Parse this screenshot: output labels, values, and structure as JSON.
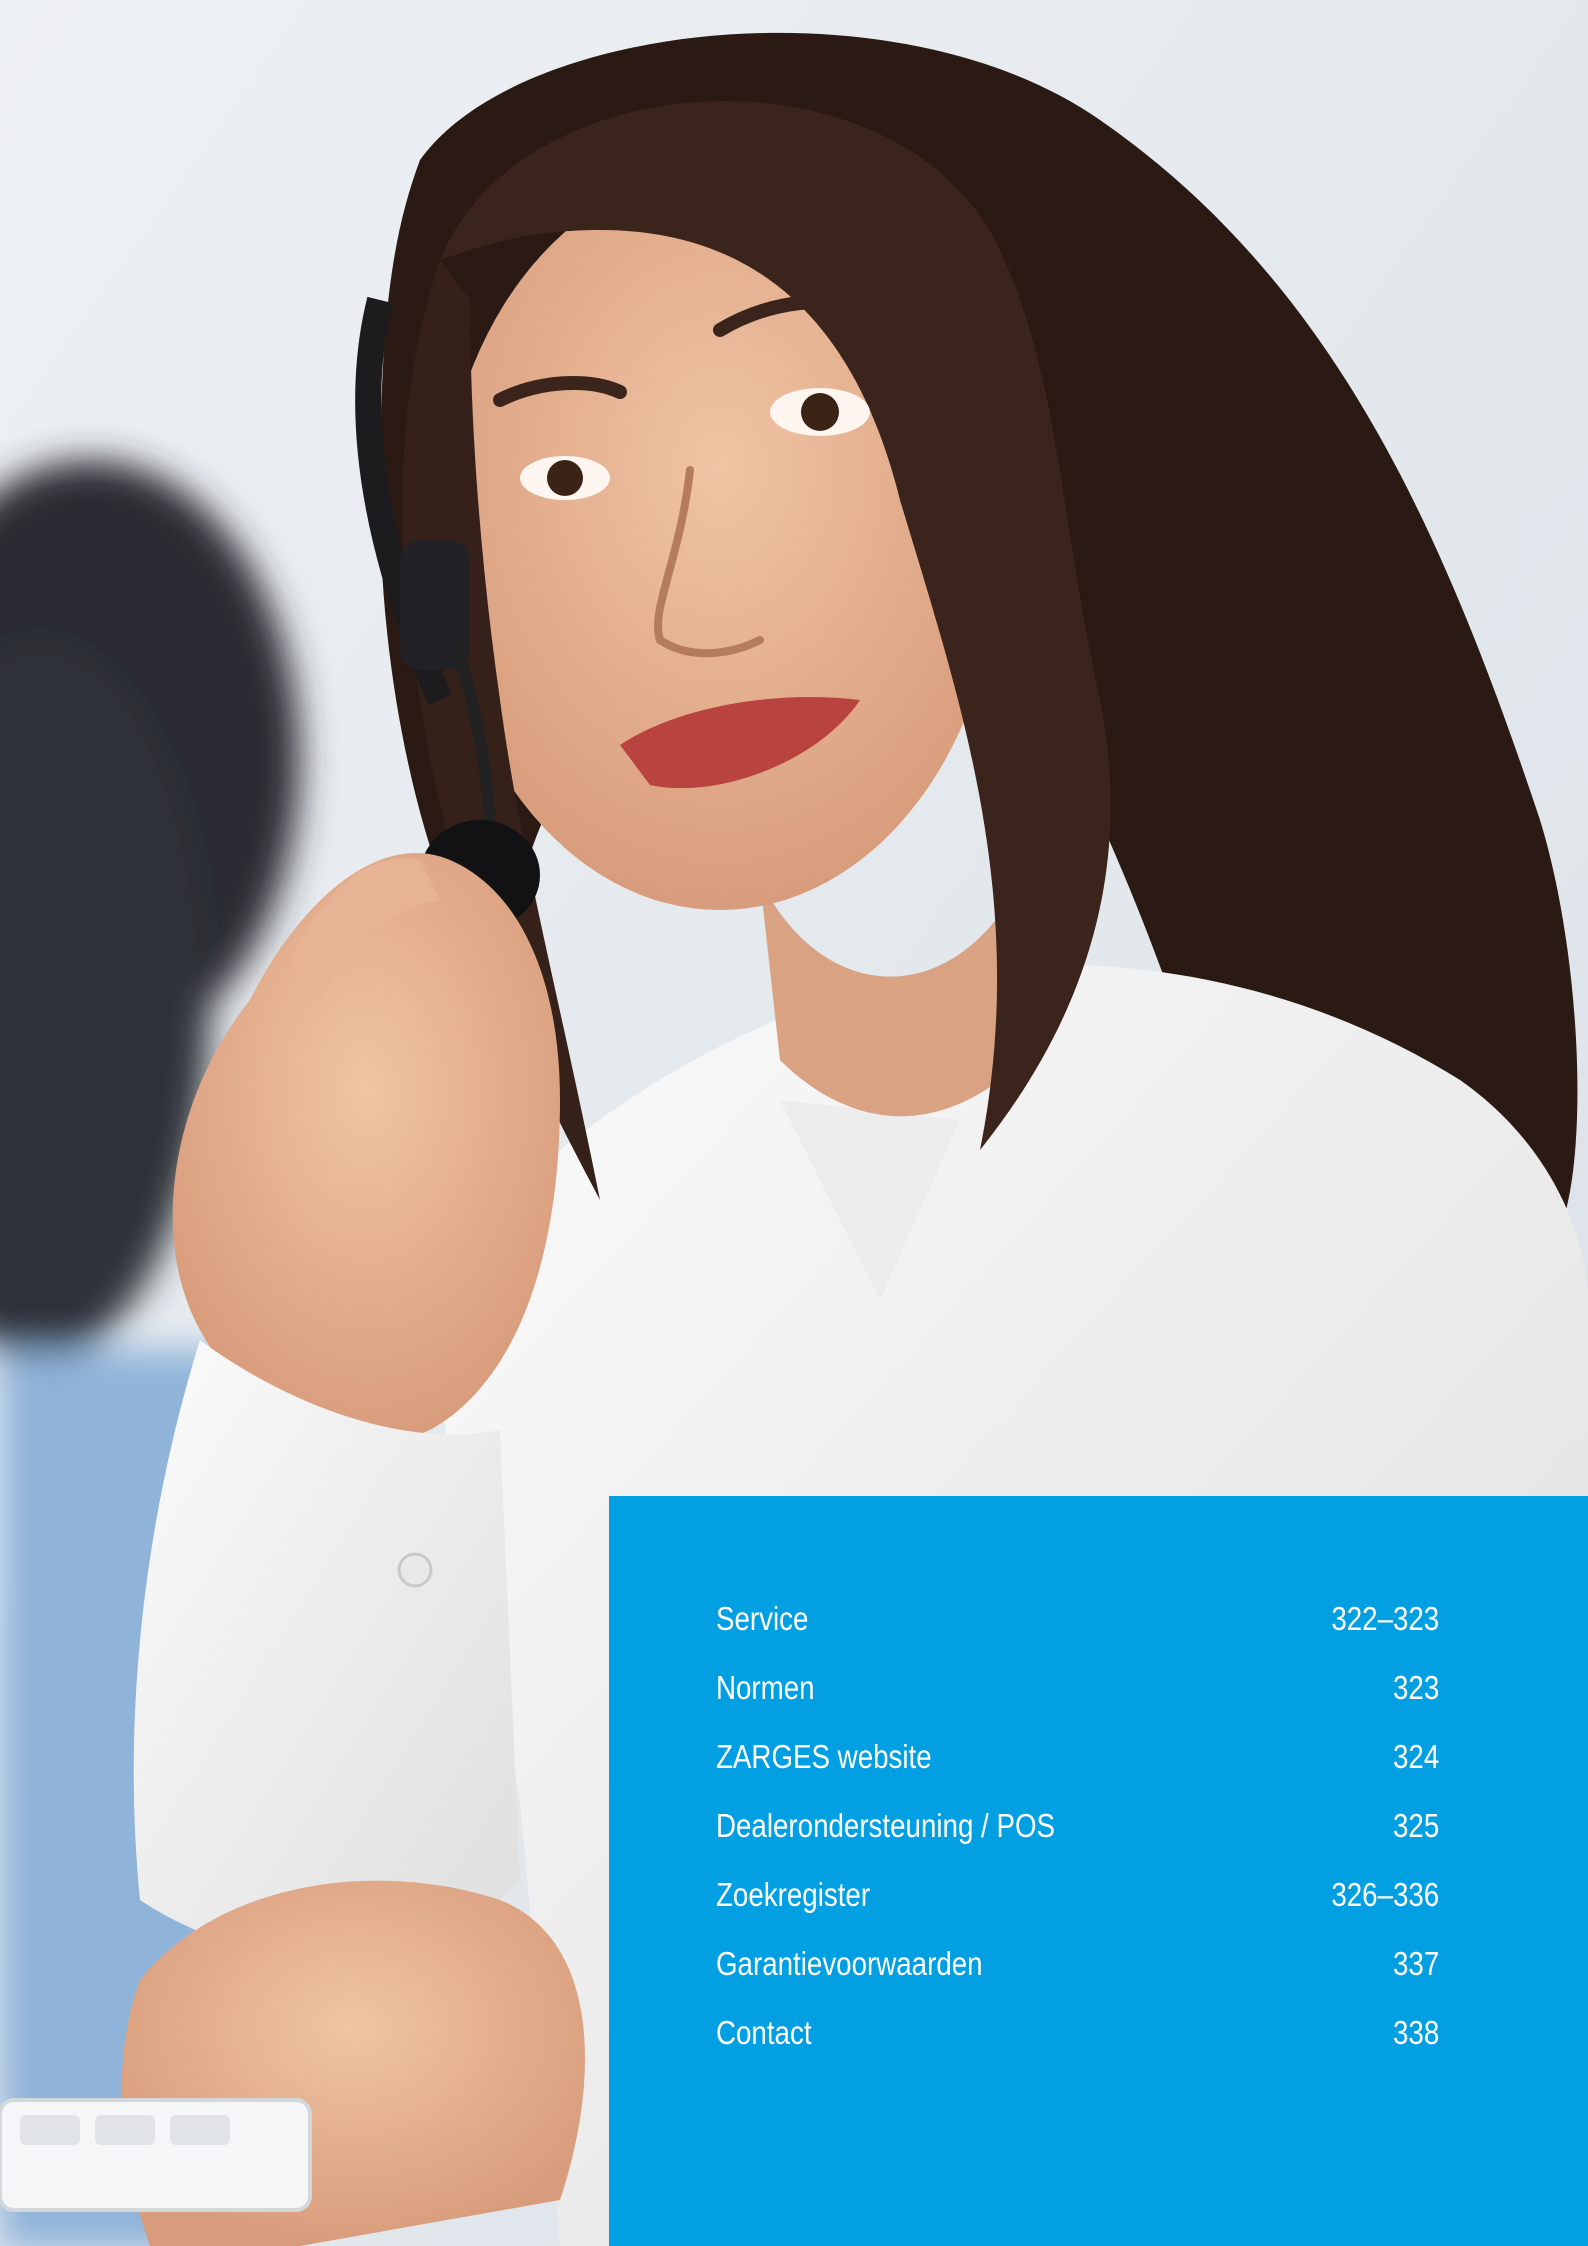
{
  "toc": {
    "items": [
      {
        "label": "Service",
        "pages": "322–323"
      },
      {
        "label": "Normen",
        "pages": "323"
      },
      {
        "label": "ZARGES website",
        "pages": "324"
      },
      {
        "label": "Dealerondersteuning / POS",
        "pages": "325"
      },
      {
        "label": "Zoekregister",
        "pages": "326–336"
      },
      {
        "label": "Garantievoorwaarden",
        "pages": "337"
      },
      {
        "label": "Contact",
        "pages": "338"
      }
    ]
  },
  "colors": {
    "panel": "#029fe3",
    "text": "#ffffff",
    "background": "#e6ebef"
  }
}
